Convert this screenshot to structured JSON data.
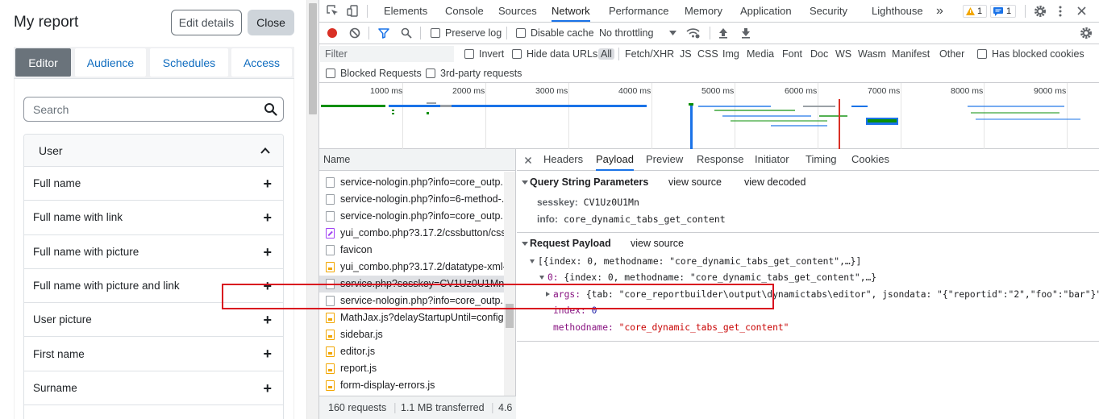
{
  "report": {
    "title": "My report",
    "edit_label": "Edit details",
    "close_label": "Close",
    "tabs": [
      "Editor",
      "Audience",
      "Schedules",
      "Access"
    ],
    "search_placeholder": "Search",
    "group": "User",
    "fields": [
      "Full name",
      "Full name with link",
      "Full name with picture",
      "Full name with picture and link",
      "User picture",
      "First name",
      "Surname"
    ]
  },
  "devtools": {
    "tabs": [
      "Elements",
      "Console",
      "Sources",
      "Network",
      "Performance",
      "Memory",
      "Application",
      "Security",
      "Lighthouse"
    ],
    "more": "»",
    "warn_count": "1",
    "msg_count": "1",
    "toolbar": {
      "preserve_log": "Preserve log",
      "disable_cache": "Disable cache",
      "throttling": "No throttling"
    },
    "filter": {
      "placeholder": "Filter",
      "invert": "Invert",
      "hide_data_urls": "Hide data URLs",
      "types": [
        "All",
        "Fetch/XHR",
        "JS",
        "CSS",
        "Img",
        "Media",
        "Font",
        "Doc",
        "WS",
        "Wasm",
        "Manifest",
        "Other"
      ],
      "has_blocked_cookies": "Has blocked cookies",
      "blocked_requests": "Blocked Requests",
      "third_party": "3rd-party requests"
    },
    "timeline_ticks": [
      "1000 ms",
      "2000 ms",
      "3000 ms",
      "4000 ms",
      "5000 ms",
      "6000 ms",
      "7000 ms",
      "8000 ms",
      "9000 ms"
    ],
    "list_header": "Name",
    "requests": [
      {
        "name": "service-nologin.php?info=core_outp...",
        "type": "doc"
      },
      {
        "name": "service-nologin.php?info=6-method-...",
        "type": "doc"
      },
      {
        "name": "service-nologin.php?info=core_outp...",
        "type": "doc"
      },
      {
        "name": "yui_combo.php?3.17.2/cssbutton/css...",
        "type": "css"
      },
      {
        "name": "favicon",
        "type": "doc"
      },
      {
        "name": "yui_combo.php?3.17.2/datatype-xml-...",
        "type": "js"
      },
      {
        "name": "service.php?sesskey=CV1Uz0U1Mn&i...",
        "type": "doc"
      },
      {
        "name": "service-nologin.php?info=core_outp...",
        "type": "doc"
      },
      {
        "name": "MathJax.js?delayStartupUntil=config...",
        "type": "js"
      },
      {
        "name": "sidebar.js",
        "type": "js"
      },
      {
        "name": "editor.js",
        "type": "js"
      },
      {
        "name": "report.js",
        "type": "js"
      },
      {
        "name": "form-display-errors.js",
        "type": "js"
      }
    ],
    "status": {
      "requests": "160 requests",
      "transferred": "1.1 MB transferred",
      "extra": "4.6"
    },
    "detail_tabs": [
      "Headers",
      "Payload",
      "Preview",
      "Response",
      "Initiator",
      "Timing",
      "Cookies"
    ],
    "qs": {
      "title": "Query String Parameters",
      "view_source": "view source",
      "view_decoded": "view decoded",
      "sesskey_key": "sesskey:",
      "sesskey_val": "CV1Uz0U1Mn",
      "info_key": "info:",
      "info_val": "core_dynamic_tabs_get_content"
    },
    "payload": {
      "title": "Request Payload",
      "view_source": "view source",
      "line1": "[{index: 0, methodname: \"core_dynamic_tabs_get_content\",…}]",
      "line2_key": "0:",
      "line2_val": "{index: 0, methodname: \"core_dynamic_tabs_get_content\",…}",
      "args_key": "args:",
      "args_val": "{tab: \"core_reportbuilder\\output\\dynamictabs\\editor\", jsondata: \"{\"reportid\":\"2\",\"foo\":\"bar\"}\"}",
      "index_key": "index:",
      "index_val": "0",
      "method_key": "methodname:",
      "method_val": "\"core_dynamic_tabs_get_content\""
    }
  }
}
